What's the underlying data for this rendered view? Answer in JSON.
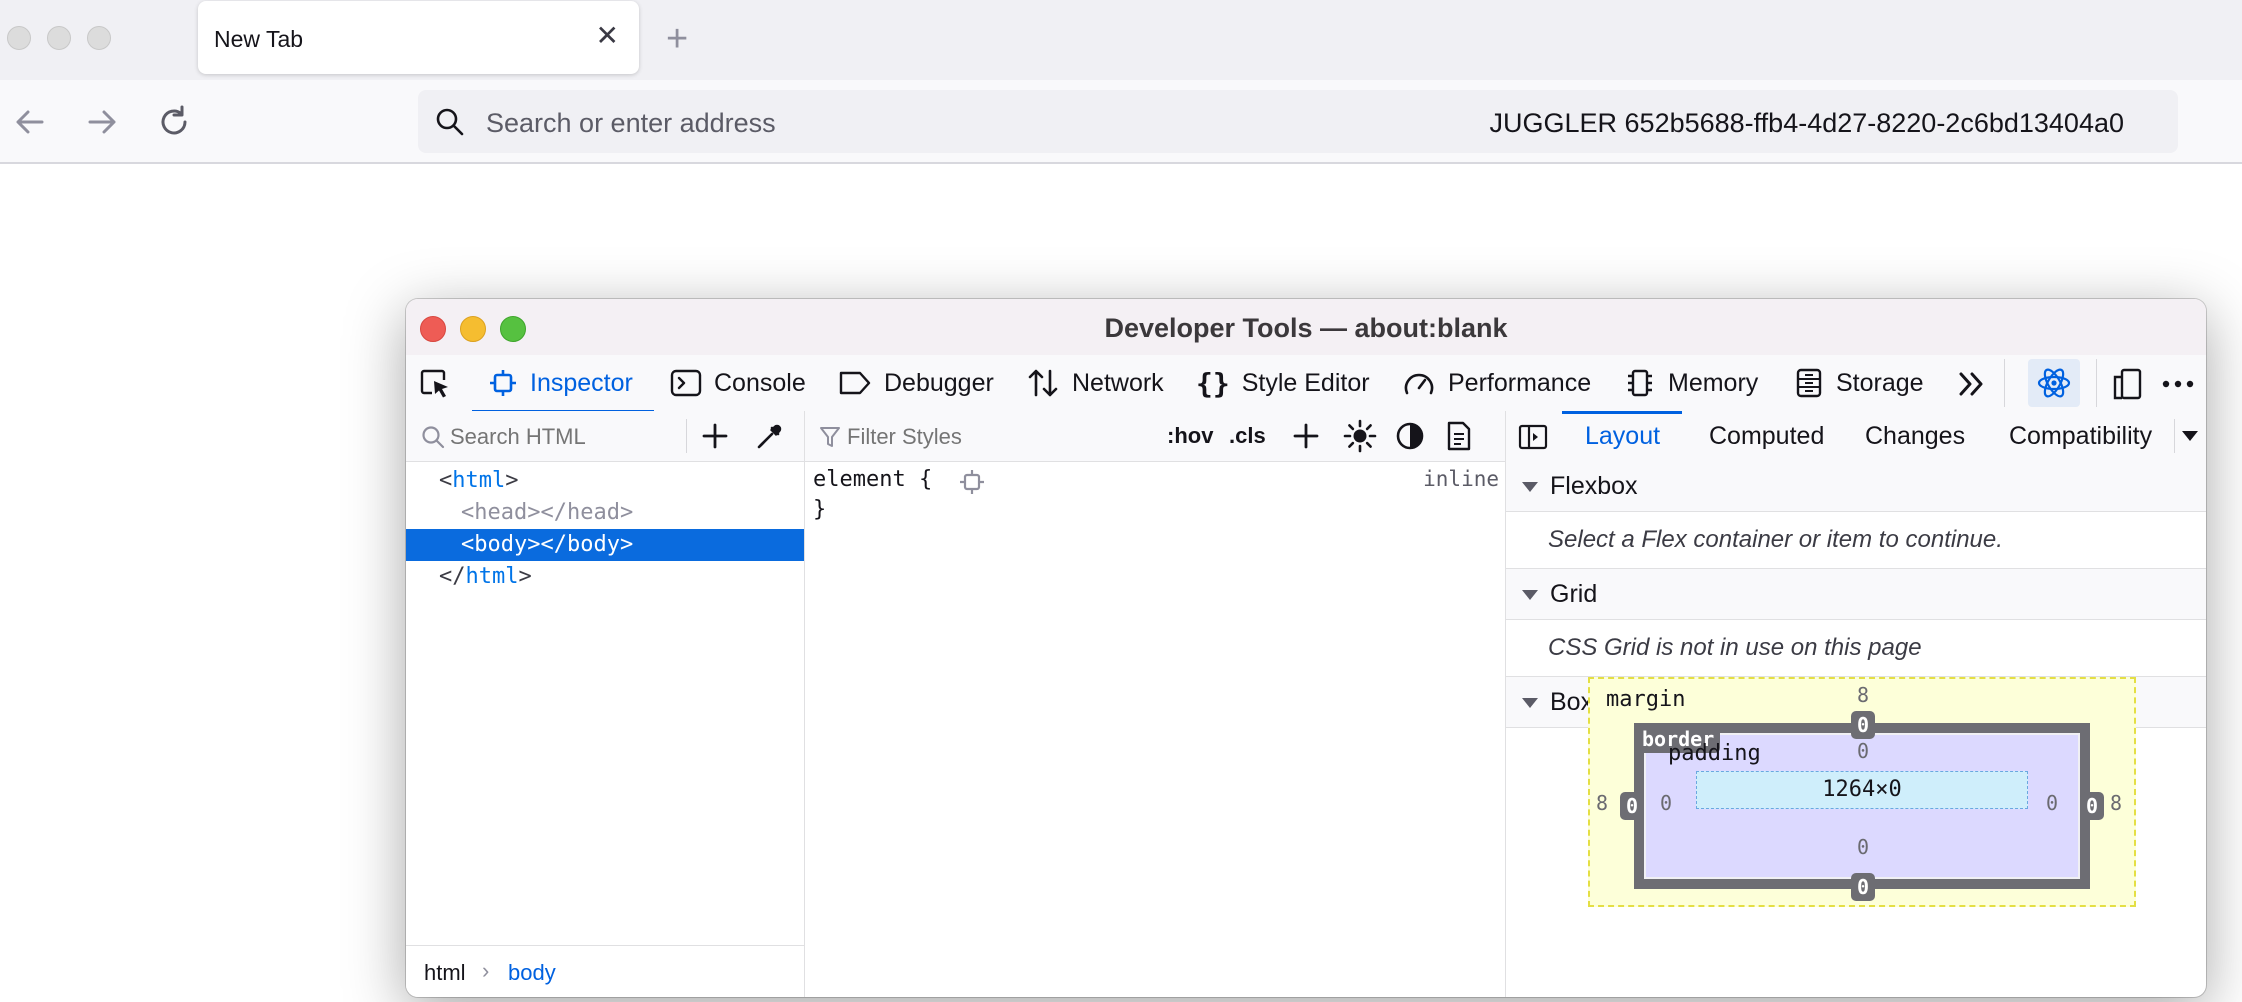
{
  "browser": {
    "tab_title": "New Tab",
    "address_placeholder": "Search or enter address",
    "juggler_text": "JUGGLER 652b5688-ffb4-4d27-8220-2c6bd13404a0"
  },
  "devtools": {
    "title": "Developer Tools — about:blank",
    "tools": [
      {
        "label": "Inspector",
        "icon": "inspector-icon"
      },
      {
        "label": "Console",
        "icon": "console-icon"
      },
      {
        "label": "Debugger",
        "icon": "debugger-icon"
      },
      {
        "label": "Network",
        "icon": "network-icon"
      },
      {
        "label": "Style Editor",
        "icon": "style-editor-icon"
      },
      {
        "label": "Performance",
        "icon": "performance-icon"
      },
      {
        "label": "Memory",
        "icon": "memory-icon"
      },
      {
        "label": "Storage",
        "icon": "storage-icon"
      }
    ],
    "selected_tool": "Inspector",
    "markup": {
      "search_placeholder": "Search HTML",
      "lines": {
        "html_open": "html",
        "head": "head",
        "head_close": "</head>",
        "body": "body",
        "body_close": "</body>",
        "html_close": "html"
      },
      "breadcrumbs": [
        "html",
        "body"
      ]
    },
    "rules": {
      "filter_placeholder": "Filter Styles",
      "hov": ":hov",
      "cls": ".cls",
      "selector": "element {",
      "close_brace": "}",
      "source": "inline"
    },
    "sidebar": {
      "tabs": [
        "Layout",
        "Computed",
        "Changes",
        "Compatibility"
      ],
      "active_tab": "Layout",
      "sections": {
        "flexbox": {
          "title": "Flexbox",
          "message": "Select a Flex container or item to continue."
        },
        "grid": {
          "title": "Grid",
          "message": "CSS Grid is not in use on this page"
        },
        "box_model": {
          "title": "Box Model",
          "margin_label": "margin",
          "border_label": "border",
          "padding_label": "padding",
          "margin": {
            "top": "8",
            "right": "8",
            "bottom": "",
            "left": "8"
          },
          "border": {
            "top": "0",
            "right": "0",
            "bottom": "0",
            "left": "0"
          },
          "padding": {
            "top": "0",
            "right": "0",
            "bottom": "0",
            "left": "0"
          },
          "content_size": "1264×0"
        }
      }
    }
  }
}
